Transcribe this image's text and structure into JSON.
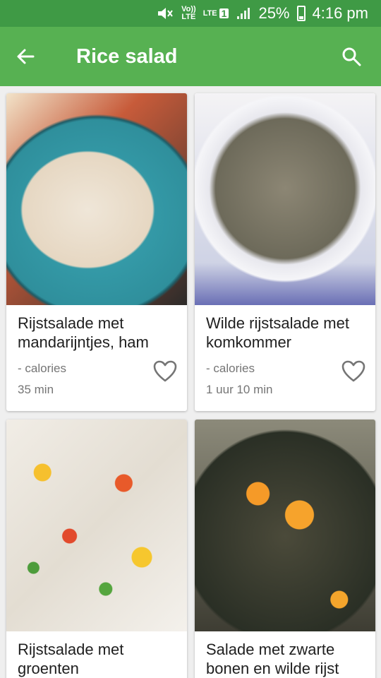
{
  "status_bar": {
    "battery_percent": "25%",
    "time": "4:16 pm",
    "network": "LTE",
    "sim_slot": "1",
    "volte_top": "Vo))",
    "volte_bottom": "LTE"
  },
  "app_bar": {
    "title": "Rice salad"
  },
  "recipes": [
    {
      "name": "Rijstsalade met mandarijntjes, ham",
      "calories": "- calories",
      "time": "35 min"
    },
    {
      "name": "Wilde rijstsalade met komkommer",
      "calories": "- calories",
      "time": "1 uur 10 min"
    },
    {
      "name": "Rijstsalade met groenten",
      "calories": "",
      "time": ""
    },
    {
      "name": "Salade met zwarte bonen en wilde rijst",
      "calories": "",
      "time": ""
    }
  ],
  "colors": {
    "status_bar": "#3f9a45",
    "app_bar": "#57b152",
    "background": "#efefef",
    "secondary_text": "#757575"
  }
}
